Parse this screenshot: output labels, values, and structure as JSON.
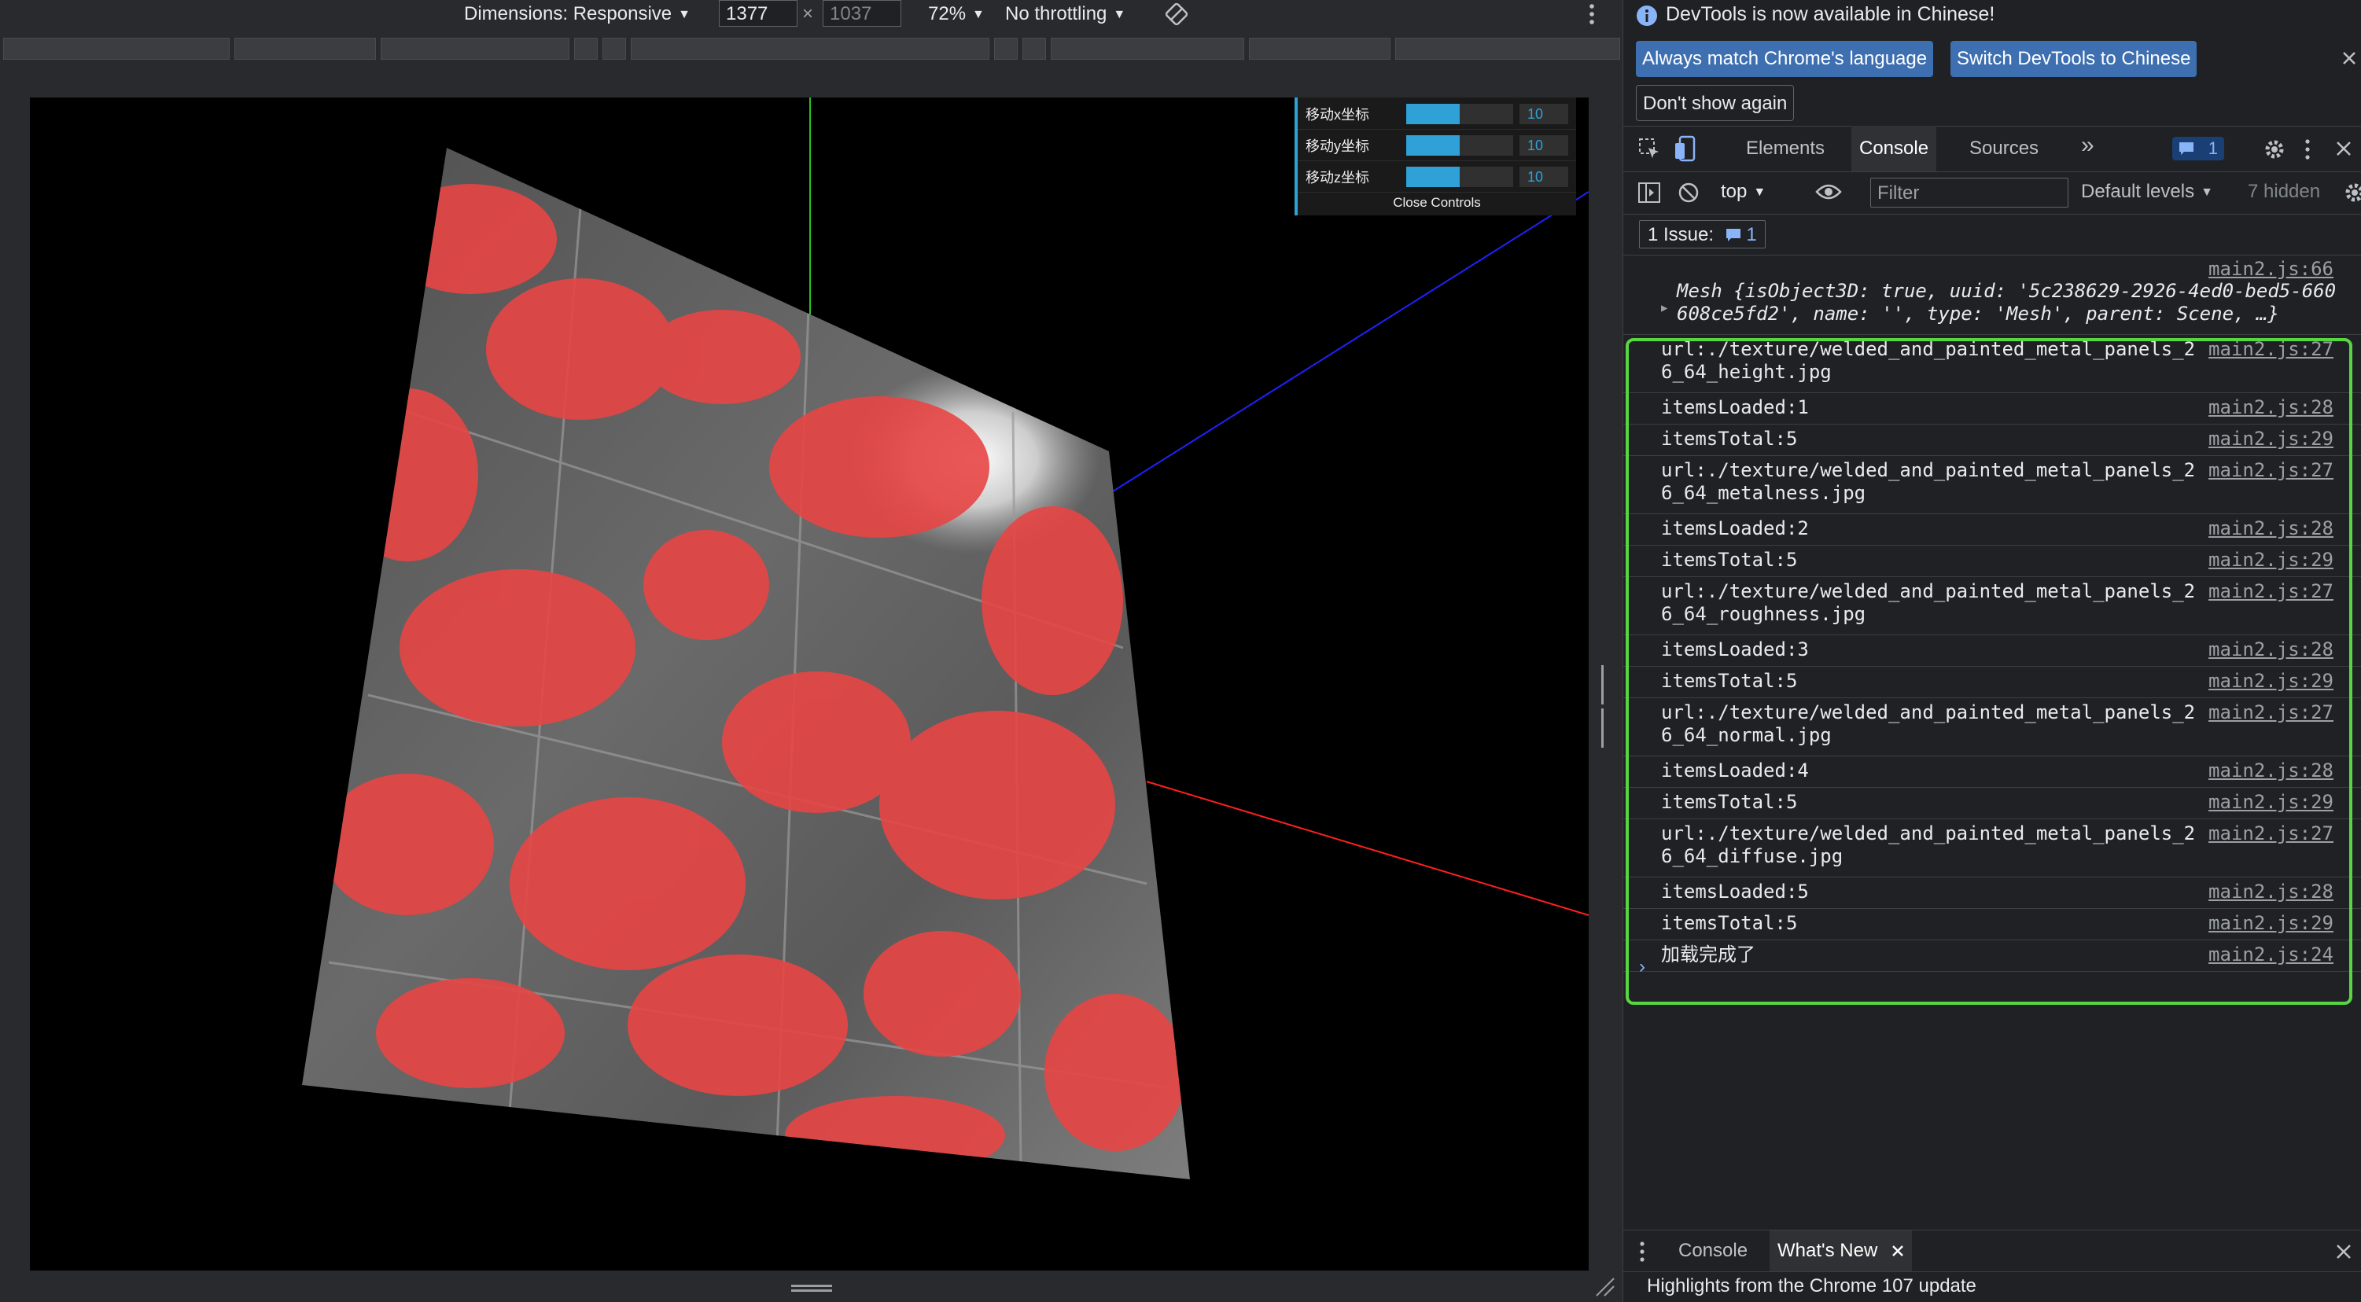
{
  "device_toolbar": {
    "dimensions_label": "Dimensions: Responsive",
    "width_value": "1377",
    "height_placeholder": "1037",
    "times": "×",
    "zoom": "72%",
    "throttling": "No throttling"
  },
  "gui": {
    "rows": [
      {
        "label": "移动x坐标",
        "value": "10",
        "fraction": 0.5
      },
      {
        "label": "移动y坐标",
        "value": "10",
        "fraction": 0.5
      },
      {
        "label": "移动z坐标",
        "value": "10",
        "fraction": 0.5
      }
    ],
    "close_label": "Close Controls"
  },
  "devtools": {
    "info_message": "DevTools is now available in Chinese!",
    "btn_match": "Always match Chrome's language",
    "btn_switch": "Switch DevTools to Chinese",
    "btn_dont_show": "Don't show again",
    "tabs": [
      "Elements",
      "Console",
      "Sources"
    ],
    "issues_badge": "1",
    "context": "top",
    "filter_placeholder": "Filter",
    "levels": "Default levels",
    "hidden": "7 hidden",
    "issues_label": "1 Issue:",
    "issues_count": "1",
    "mesh_source": "main2.js:66",
    "mesh_line1": "Mesh {isObject3D: true, uuid: '5c238629-2926-4ed0-bed5-660",
    "mesh_line2": "608ce5fd2', name: '', type: 'Mesh', parent: Scene, …}",
    "logs": [
      {
        "msg": "url:./texture/welded_and_painted_metal_panels_26_64_height.jpg",
        "src": "main2.js:27"
      },
      {
        "msg": "itemsLoaded:1",
        "src": "main2.js:28"
      },
      {
        "msg": "itemsTotal:5",
        "src": "main2.js:29"
      },
      {
        "msg": "url:./texture/welded_and_painted_metal_panels_26_64_metalness.jpg",
        "src": "main2.js:27"
      },
      {
        "msg": "itemsLoaded:2",
        "src": "main2.js:28"
      },
      {
        "msg": "itemsTotal:5",
        "src": "main2.js:29"
      },
      {
        "msg": "url:./texture/welded_and_painted_metal_panels_26_64_roughness.jpg",
        "src": "main2.js:27"
      },
      {
        "msg": "itemsLoaded:3",
        "src": "main2.js:28"
      },
      {
        "msg": "itemsTotal:5",
        "src": "main2.js:29"
      },
      {
        "msg": "url:./texture/welded_and_painted_metal_panels_26_64_normal.jpg",
        "src": "main2.js:27"
      },
      {
        "msg": "itemsLoaded:4",
        "src": "main2.js:28"
      },
      {
        "msg": "itemsTotal:5",
        "src": "main2.js:29"
      },
      {
        "msg": "url:./texture/welded_and_painted_metal_panels_26_64_diffuse.jpg",
        "src": "main2.js:27"
      },
      {
        "msg": "itemsLoaded:5",
        "src": "main2.js:28"
      },
      {
        "msg": "itemsTotal:5",
        "src": "main2.js:29"
      },
      {
        "msg": "加载完成了",
        "src": "main2.js:24"
      }
    ],
    "drawer_tabs": [
      "Console",
      "What's New"
    ],
    "drawer_message": "Highlights from the Chrome 107 update"
  }
}
